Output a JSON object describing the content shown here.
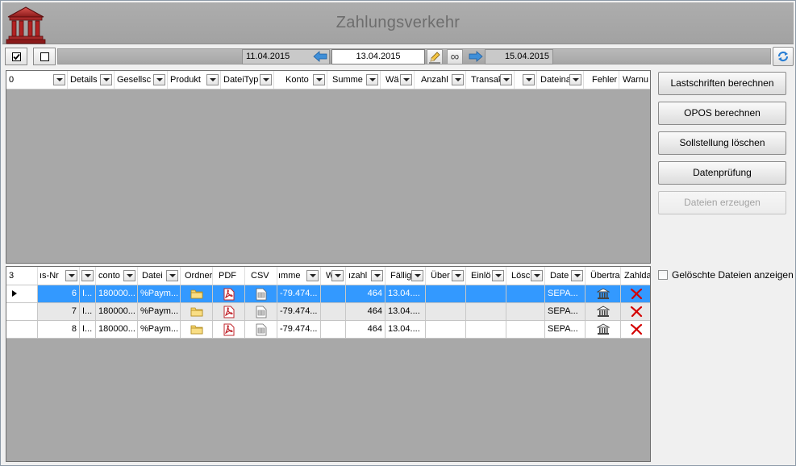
{
  "window": {
    "title": "Zahlungsverkehr"
  },
  "icons": {
    "logo": "bank-building-icon",
    "prev": "arrow-left-icon",
    "next": "arrow-right-icon",
    "edit": "pencil-icon",
    "infinity": "infinity-icon",
    "refresh": "refresh-icon",
    "folder": "folder-icon",
    "pdf": "pdf-icon",
    "csv": "csv-icon",
    "bank": "bank-icon",
    "delete": "red-x-icon"
  },
  "colors": {
    "selection": "#3399ff",
    "header_bar": "#a8a8a8",
    "grid_bg": "#a8a8a8",
    "delete": "#d40000",
    "pdf": "#c0242b",
    "folder": "#f2c94c"
  },
  "toolbar": {
    "date_prev": "11.04.2015",
    "date_current": "13.04.2015",
    "date_next": "15.04.2015",
    "infinity_symbol": "∞"
  },
  "grid_top": {
    "count": "0",
    "columns": [
      "Details",
      "Gesellsc",
      "Produkt",
      "DateiTyp",
      "Konto",
      "Summe",
      "Wä",
      "Anzahl",
      "Transak",
      "",
      "Dateina",
      "Fehler",
      "Warnu"
    ]
  },
  "grid_bottom": {
    "count": "3",
    "columns": [
      "ıs-Nr",
      "",
      "conto",
      "Datei",
      "Ordner",
      "PDF",
      "CSV",
      "ımme",
      "W",
      "ızahl",
      "Fällig",
      "Über",
      "Einlö",
      "Lösc",
      "Date",
      "Übertra",
      "Zahlda"
    ],
    "rows": [
      {
        "nr": "6",
        "c1": "I...",
        "konto": "180000...",
        "datei": "%Paym...",
        "summe": "-79.474...",
        "anzahl": "464",
        "faellig": "13.04....",
        "dateiname": "SEPA...",
        "selected": true
      },
      {
        "nr": "7",
        "c1": "I...",
        "konto": "180000...",
        "datei": "%Paym...",
        "summe": "-79.474...",
        "anzahl": "464",
        "faellig": "13.04....",
        "dateiname": "SEPA...",
        "selected": false
      },
      {
        "nr": "8",
        "c1": "I...",
        "konto": "180000...",
        "datei": "%Paym...",
        "summe": "-79.474...",
        "anzahl": "464",
        "faellig": "13.04....",
        "dateiname": "SEPA...",
        "selected": false
      }
    ]
  },
  "actions": {
    "lastschriften": "Lastschriften berechnen",
    "opos": "OPOS berechnen",
    "sollstellung": "Sollstellung löschen",
    "datenpruefung": "Datenprüfung",
    "dateien_erzeugen": "Dateien erzeugen"
  },
  "options": {
    "geloeschte_label": "Gelöschte Dateien anzeigen",
    "geloeschte_checked": false
  }
}
